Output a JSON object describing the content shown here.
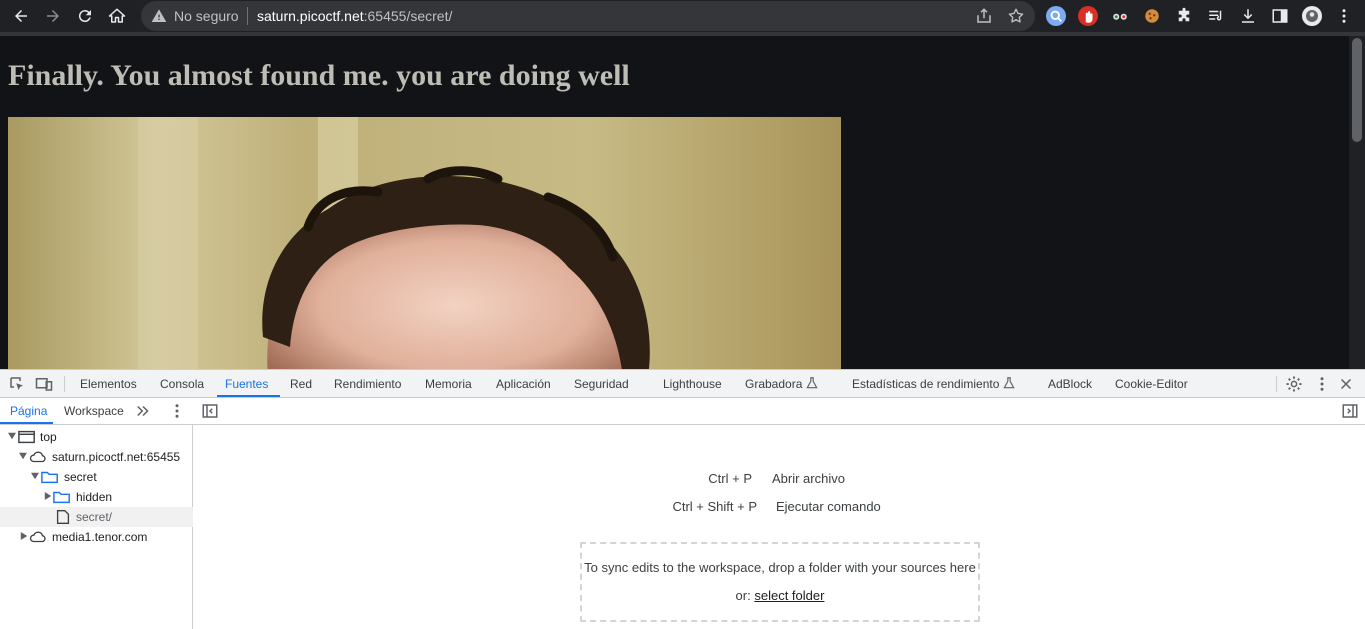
{
  "browser": {
    "security_label": "No seguro",
    "url_host": "saturn.picoctf.net",
    "url_path": ":65455/secret/"
  },
  "page": {
    "heading": "Finally. You almost found me. you are doing well"
  },
  "devtools": {
    "tabs": [
      "Elementos",
      "Consola",
      "Fuentes",
      "Red",
      "Rendimiento",
      "Memoria",
      "Aplicación",
      "Seguridad",
      "Lighthouse",
      "Grabadora",
      "Estadísticas de rendimiento",
      "AdBlock",
      "Cookie-Editor"
    ],
    "active_tab": "Fuentes",
    "sources": {
      "nav_tabs": [
        "Página",
        "Workspace"
      ],
      "active_nav_tab": "Página",
      "tree": {
        "top": "top",
        "host": "saturn.picoctf.net:65455",
        "folder_secret": "secret",
        "folder_hidden": "hidden",
        "file_secret": "secret/",
        "host_media": "media1.tenor.com"
      },
      "shortcuts": [
        {
          "keys": "Ctrl + P",
          "action": "Abrir archivo"
        },
        {
          "keys": "Ctrl + Shift + P",
          "action": "Ejecutar comando"
        }
      ],
      "drop_text": "To sync edits to the workspace, drop a folder with your sources here or:",
      "drop_link": "select folder"
    }
  },
  "colors": {
    "page_bg": "#121317",
    "heading": "#bdbdb5",
    "accent": "#1a73e8",
    "toolbar": "#202124"
  }
}
